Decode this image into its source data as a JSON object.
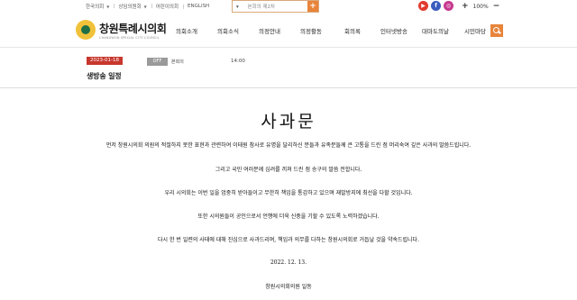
{
  "util": {
    "links": [
      {
        "label": "한국의회",
        "dropdown": true
      },
      {
        "label": "상임의원회",
        "dropdown": true
      },
      {
        "label": "어린이의회",
        "dropdown": false
      },
      {
        "label": "ENGLISH",
        "dropdown": false
      }
    ],
    "search": {
      "scope": "",
      "placeholder": "본회의 제2차",
      "button_label": "+"
    },
    "sns": [
      {
        "name": "youtube-icon",
        "color": "#e23a2e",
        "glyph": "▶"
      },
      {
        "name": "facebook-icon",
        "color": "#3b5dbe",
        "glyph": "f"
      },
      {
        "name": "instagram-icon",
        "color": "#c7398f",
        "glyph": "◎"
      }
    ],
    "zoom": {
      "plus": "+",
      "value": "100%",
      "minus": "−"
    }
  },
  "header": {
    "site_name": "창원특례시의회",
    "site_name_en": "CHANGWON SPECIAL CITY COUNCIL",
    "nav": [
      "의회소개",
      "의회소식",
      "의정안내",
      "의정활동",
      "회의록",
      "인터넷방송",
      "대마도의날",
      "시민마당"
    ]
  },
  "live": {
    "date": "2023-01-18",
    "title": "생방송 일정",
    "status": "OFF",
    "session": "본회의",
    "time": "14:00"
  },
  "apology": {
    "heading": "사과문",
    "paragraphs": [
      "먼저 창원시의회 의원의 적절하지 못한 표현과 관련하여 이태원 참사로 유명을 달리하신 분들과 유족분들께 큰 고통을 드린 점 머리숙여 깊은 사과의 말씀드립니다.",
      "그리고 국민 여러분께 심려를 끼쳐 드린 점 송구의 말씀 전합니다.",
      "우리 시의회는 이번 일을 엄중히 받아들이고 무한히 책임을 통감하고 있으며 재발방지에 최선을 다할 것입니다.",
      "또한 시의원들이 공인으로서 언행에 더욱 신중을 기할 수 있도록 노력하겠습니다.",
      "다시 한 번 일련의 사태에 대해 진심으로 사과드리며, 책임과 의무를 다하는 창원시의회로 거듭날 것을 약속드립니다.",
      "2022. 12. 13.",
      "창원시의회의원 일동"
    ]
  }
}
